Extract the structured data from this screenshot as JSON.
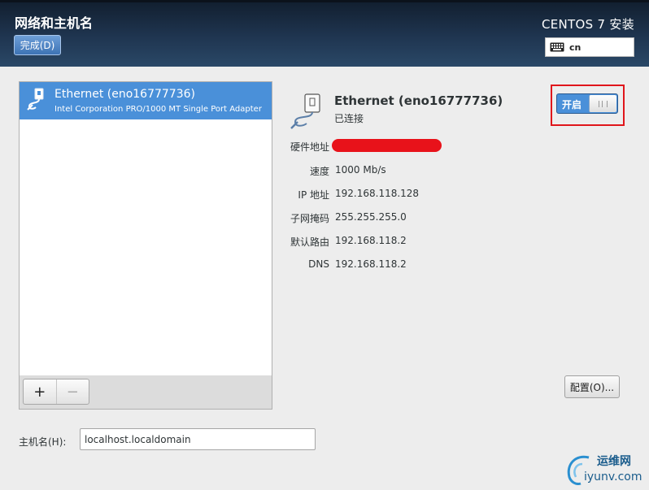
{
  "header": {
    "page_title": "网络和主机名",
    "done_button": "完成(D)",
    "product_title": "CENTOS 7 安装",
    "keyboard": {
      "icon": "keyboard-icon",
      "label": "cn"
    }
  },
  "device_list": {
    "items": [
      {
        "icon": "ethernet-cable-icon",
        "name": "Ethernet (eno16777736)",
        "description": "Intel Corporation PRO/1000 MT Single Port Adapter",
        "selected": true
      }
    ],
    "add_label": "+",
    "remove_label": "−"
  },
  "device_detail": {
    "icon": "ethernet-cable-icon",
    "name": "Ethernet (eno16777736)",
    "status": "已连接",
    "toggle": {
      "label": "开启",
      "on": true
    },
    "properties": [
      {
        "label": "硬件地址",
        "value": ""
      },
      {
        "label": "速度",
        "value": "1000 Mb/s"
      },
      {
        "label": "IP 地址",
        "value": "192.168.118.128"
      },
      {
        "label": "子网掩码",
        "value": "255.255.255.0"
      },
      {
        "label": "默认路由",
        "value": "192.168.118.2"
      },
      {
        "label": "DNS",
        "value": "192.168.118.2"
      }
    ],
    "configure_button": "配置(O)..."
  },
  "hostname": {
    "label": "主机名(H):",
    "value": "localhost.localdomain"
  },
  "watermark": {
    "title": "运维网",
    "url": "iyunv.com"
  },
  "colors": {
    "header_bg": "#1f3550",
    "selection": "#4a90d9",
    "highlight_frame": "#e0161b"
  }
}
